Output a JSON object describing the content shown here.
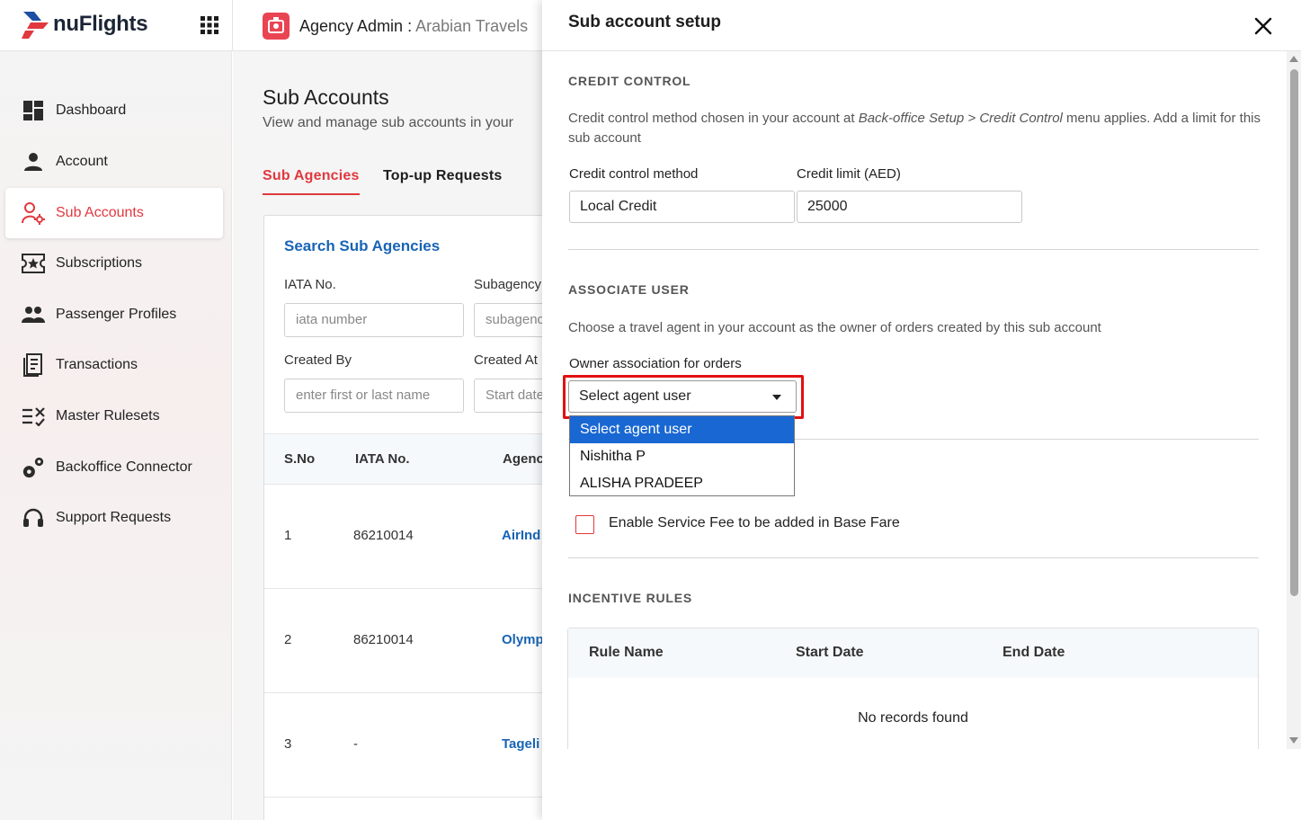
{
  "brand": {
    "name": "nuFlights",
    "accent_color": "#e0383e",
    "link_color": "#1864b5"
  },
  "header": {
    "title": "Agency Admin",
    "separator": " : ",
    "org": "Arabian Travels"
  },
  "sidebar": {
    "items": [
      {
        "label": "Dashboard",
        "icon": "dashboard-icon"
      },
      {
        "label": "Account",
        "icon": "person-icon"
      },
      {
        "label": "Sub Accounts",
        "icon": "sub-accounts-icon"
      },
      {
        "label": "Subscriptions",
        "icon": "ticket-star-icon"
      },
      {
        "label": "Passenger Profiles",
        "icon": "people-icon"
      },
      {
        "label": "Transactions",
        "icon": "receipt-icon"
      },
      {
        "label": "Master Rulesets",
        "icon": "checklist-icon"
      },
      {
        "label": "Backoffice Connector",
        "icon": "gears-icon"
      },
      {
        "label": "Support Requests",
        "icon": "headset-icon"
      }
    ],
    "active": "Sub Accounts"
  },
  "main": {
    "title": "Sub Accounts",
    "subtitle": "View and manage sub accounts in your",
    "tabs": [
      {
        "label": "Sub Agencies"
      },
      {
        "label": "Top-up Requests"
      }
    ],
    "search": {
      "title": "Search Sub Agencies",
      "iata_label": "IATA No.",
      "iata_placeholder": "iata number",
      "subagency_label": "Subagency",
      "subagency_placeholder": "subagenc",
      "created_by_label": "Created By",
      "created_by_placeholder": "enter first or last name",
      "created_at_label": "Created At",
      "created_at_placeholder": "Start date"
    },
    "table": {
      "headers": [
        "S.No",
        "IATA No.",
        "Agenc"
      ],
      "rows": [
        {
          "sno": "1",
          "iata": "86210014",
          "agency": "AirInd"
        },
        {
          "sno": "2",
          "iata": "86210014",
          "agency": "Olymp"
        },
        {
          "sno": "3",
          "iata": "-",
          "agency": "Tageli"
        }
      ]
    }
  },
  "drawer": {
    "title": "Sub account setup",
    "credit": {
      "section_title": "CREDIT CONTROL",
      "desc_prefix": "Credit control method chosen in your account at ",
      "desc_path": "Back-office Setup > Credit Control",
      "desc_suffix": " menu applies. Add a limit for this sub account",
      "method_label": "Credit control method",
      "method_value": "Local Credit",
      "limit_label": "Credit limit (AED)",
      "limit_value": "25000"
    },
    "associate": {
      "section_title": "ASSOCIATE USER",
      "desc": "Choose a travel agent in your account as the owner of orders created by this sub account",
      "owner_label": "Owner association for orders",
      "selected": "Select agent user",
      "options": [
        "Select agent user",
        "Nishitha P",
        "ALISHA PRADEEP"
      ]
    },
    "service_fee": {
      "checkbox_label": "Enable Service Fee to be added in Base Fare",
      "checked": false
    },
    "incentive": {
      "section_title": "INCENTIVE RULES",
      "headers": [
        "Rule Name",
        "Start Date",
        "End Date"
      ],
      "empty": "No records found"
    }
  }
}
